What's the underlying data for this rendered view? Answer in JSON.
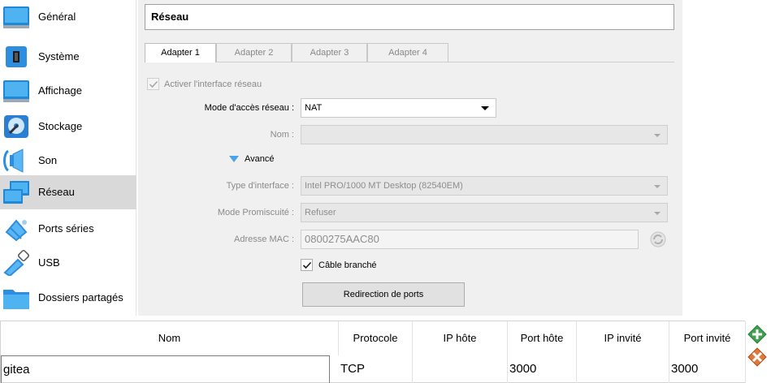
{
  "sidebar": {
    "items": [
      {
        "label": "Général",
        "icon": "general-icon"
      },
      {
        "label": "Système",
        "icon": "system-icon"
      },
      {
        "label": "Affichage",
        "icon": "display-icon"
      },
      {
        "label": "Stockage",
        "icon": "storage-icon"
      },
      {
        "label": "Son",
        "icon": "audio-icon"
      },
      {
        "label": "Réseau",
        "icon": "network-icon",
        "selected": true
      },
      {
        "label": "Ports séries",
        "icon": "serial-ports-icon"
      },
      {
        "label": "USB",
        "icon": "usb-icon"
      },
      {
        "label": "Dossiers partagés",
        "icon": "shared-folders-icon"
      }
    ]
  },
  "header": {
    "title": "Réseau"
  },
  "tabs": [
    {
      "label": "Adapter 1",
      "active": true
    },
    {
      "label": "Adapter 2"
    },
    {
      "label": "Adapter 3"
    },
    {
      "label": "Adapter 4"
    }
  ],
  "form": {
    "enable_label": "Activer l'interface réseau",
    "enable_checked": true,
    "attached_label": "Mode d'accès réseau :",
    "attached_value": "NAT",
    "name_label": "Nom :",
    "name_value": "",
    "advanced_label": "Avancé",
    "adapter_type_label": "Type d'interface :",
    "adapter_type_value": "Intel PRO/1000 MT Desktop (82540EM)",
    "promisc_label": "Mode Promiscuité :",
    "promisc_value": "Refuser",
    "mac_label": "Adresse MAC :",
    "mac_value": "0800275AAC80",
    "cable_label": "Câble branché",
    "cable_checked": true,
    "port_forward_button": "Redirection de ports"
  },
  "port_forwarding": {
    "columns": [
      "Nom",
      "Protocole",
      "IP hôte",
      "Port hôte",
      "IP invité",
      "Port invité"
    ],
    "rows": [
      [
        "gitea",
        "TCP",
        "",
        "3000",
        "",
        "3000"
      ]
    ],
    "add_icon": "add-rule-icon",
    "remove_icon": "remove-rule-icon"
  },
  "colors": {
    "selected_item_bg": "#d9d9d9",
    "panel_bg": "#f0f0f0",
    "accent_blue": "#4aa3e8"
  }
}
